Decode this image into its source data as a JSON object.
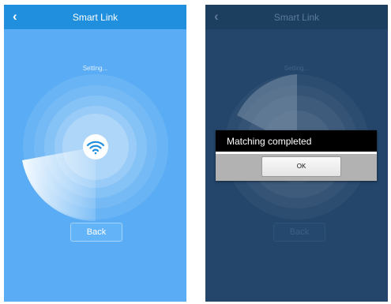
{
  "left_screen": {
    "header": {
      "back_glyph": "‹",
      "title": "Smart Link"
    },
    "status_text": "Setting...",
    "center_icon": "wifi-icon",
    "back_button": "Back"
  },
  "right_screen": {
    "header": {
      "back_glyph": "‹",
      "title": "Smart Link"
    },
    "status_text": "Setting...",
    "back_button": "Back",
    "dialog": {
      "title": "Matching completed",
      "ok_button": "OK"
    }
  },
  "colors": {
    "accent_blue": "#1f8fde",
    "screen_blue": "#5aadf5",
    "dimmed_screen": "#24466b",
    "dialog_title_bg": "#000000"
  }
}
